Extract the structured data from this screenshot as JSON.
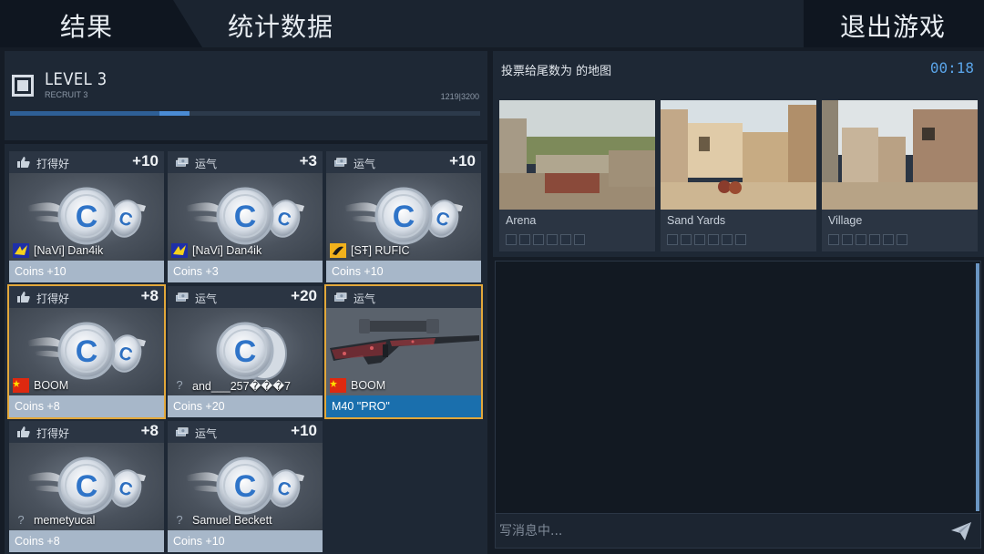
{
  "tabs": {
    "results": "结果",
    "stats": "统计数据",
    "exit": "退出游戏"
  },
  "level": {
    "title": "LEVEL 3",
    "rank": "RECRUIT 3",
    "xp_current": 1219,
    "xp_max": 3200,
    "xp_text": "1219|3200",
    "xp_gain_fraction": 0.064
  },
  "cards": [
    {
      "category": "打得好",
      "category_icon": "thumbs-up-icon",
      "points": "+10",
      "player": "[NaVi] Dan4ik",
      "flag": "ukraine-flag",
      "reward": "Coins +10",
      "reward_type": "coins",
      "highlight": false
    },
    {
      "category": "运气",
      "category_icon": "money-icon",
      "points": "+3",
      "player": "[NaVi] Dan4ik",
      "flag": "ukraine-flag",
      "reward": "Coins +3",
      "reward_type": "coins",
      "highlight": false
    },
    {
      "category": "运气",
      "category_icon": "money-icon",
      "points": "+10",
      "player": "[SŦ] RUFIC",
      "flag": "team-logo-flag",
      "reward": "Coins +10",
      "reward_type": "coins",
      "highlight": false
    },
    {
      "category": "打得好",
      "category_icon": "thumbs-up-icon",
      "points": "+8",
      "player": "BOOM",
      "flag": "china-flag",
      "reward": "Coins +8",
      "reward_type": "coins",
      "highlight": true
    },
    {
      "category": "运气",
      "category_icon": "money-icon",
      "points": "+20",
      "player": "and___257���7",
      "flag": "unknown-flag",
      "reward": "Coins +20",
      "reward_type": "coins",
      "highlight": false
    },
    {
      "category": "运气",
      "category_icon": "money-icon",
      "points": "",
      "player": "BOOM",
      "flag": "china-flag",
      "reward": "M40 \"PRO\"",
      "reward_type": "weapon",
      "highlight": true
    },
    {
      "category": "打得好",
      "category_icon": "thumbs-up-icon",
      "points": "+8",
      "player": "memetyucal",
      "flag": "unknown-flag",
      "reward": "Coins +8",
      "reward_type": "coins",
      "highlight": false
    },
    {
      "category": "运气",
      "category_icon": "money-icon",
      "points": "+10",
      "player": "Samuel Beckett",
      "flag": "unknown-flag",
      "reward": "Coins +10",
      "reward_type": "coins",
      "highlight": false
    }
  ],
  "vote": {
    "title": "投票给尾数为 的地图",
    "timer": "00:18",
    "maps": [
      {
        "name": "Arena",
        "votes": 0,
        "slots": 6
      },
      {
        "name": "Sand Yards",
        "votes": 0,
        "slots": 6
      },
      {
        "name": "Village",
        "votes": 0,
        "slots": 6
      }
    ]
  },
  "chat": {
    "placeholder": "写消息中...",
    "send_icon": "send-icon"
  },
  "colors": {
    "accent_blue": "#5aa4e8",
    "highlight_gold": "#e3a83a",
    "coin_footer": "#a7b7c9",
    "weapon_footer": "#1a6fad"
  },
  "unknown_flag_glyph": "?"
}
